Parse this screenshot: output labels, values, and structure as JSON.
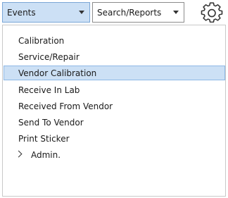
{
  "toolbar": {
    "events_label": "Events",
    "search_label": "Search/Reports",
    "settings_icon": "gear-icon"
  },
  "menu": {
    "items": [
      {
        "label": "Calibration"
      },
      {
        "label": "Service/Repair"
      },
      {
        "label": "Vendor Calibration",
        "selected": true
      },
      {
        "label": "Receive In Lab"
      },
      {
        "label": "Received From Vendor"
      },
      {
        "label": "Send To Vendor"
      },
      {
        "label": "Print Sticker"
      }
    ],
    "admin_label": "Admin.",
    "admin_icon": "chevron-right-icon"
  },
  "colors": {
    "selection_bg": "#cce0f5",
    "selection_border": "#8eb8e6"
  }
}
